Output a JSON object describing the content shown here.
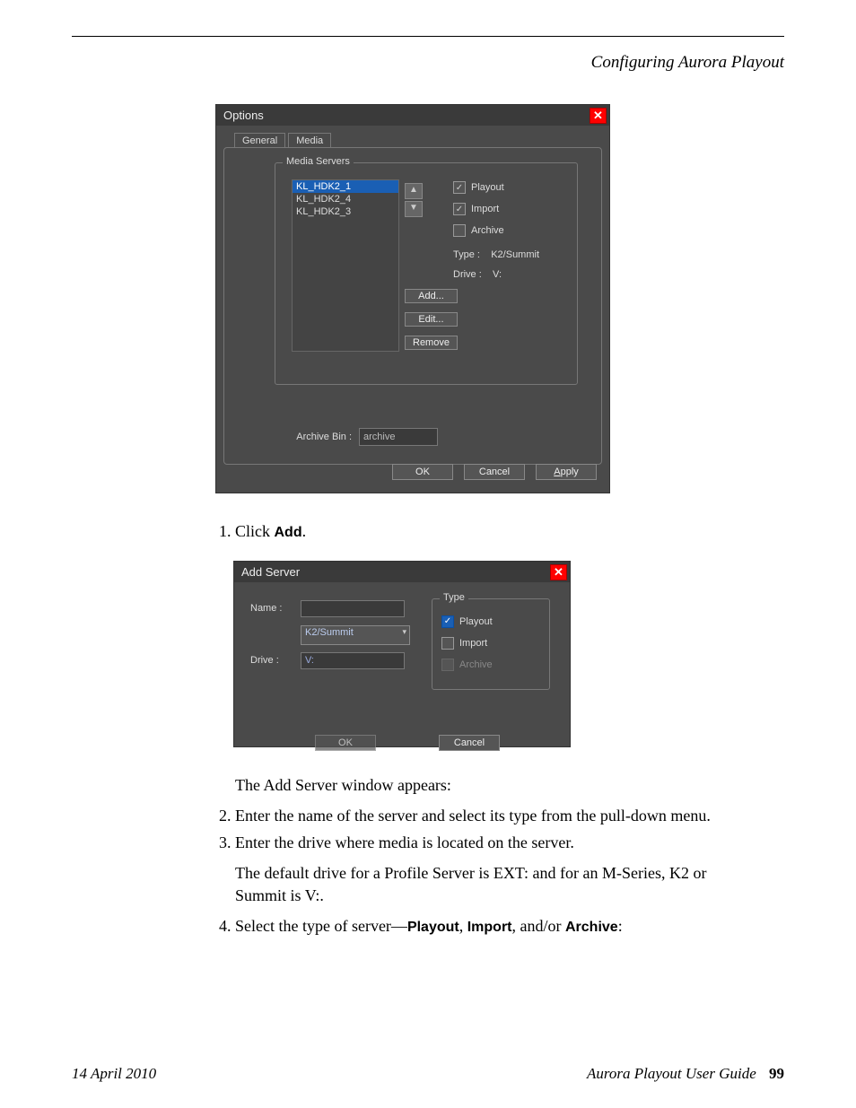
{
  "header": {
    "section_title": "Configuring Aurora Playout"
  },
  "options_dialog": {
    "title": "Options",
    "tabs": {
      "general": "General",
      "media": "Media"
    },
    "group_label": "Media Servers",
    "servers": [
      "KL_HDK2_1",
      "KL_HDK2_4",
      "KL_HDK2_3"
    ],
    "checks": {
      "playout": "Playout",
      "import": "Import",
      "archive": "Archive"
    },
    "type_label": "Type :",
    "type_value": "K2/Summit",
    "drive_label": "Drive :",
    "drive_value": "V:",
    "buttons": {
      "add": "Add...",
      "edit": "Edit...",
      "remove": "Remove"
    },
    "archive_bin_label": "Archive Bin :",
    "archive_bin_value": "archive",
    "footer_buttons": {
      "ok": "OK",
      "cancel": "Cancel",
      "apply": "Apply"
    }
  },
  "step1": {
    "prefix": "Click ",
    "bold": "Add",
    "suffix": "."
  },
  "addserver_dialog": {
    "title": "Add Server",
    "name_label": "Name :",
    "name_value": "",
    "type_select_value": "K2/Summit",
    "drive_label": "Drive :",
    "drive_value": "V:",
    "group_label": "Type",
    "checks": {
      "playout": "Playout",
      "import": "Import",
      "archive": "Archive"
    },
    "buttons": {
      "ok": "OK",
      "cancel": "Cancel"
    }
  },
  "paragraphs": {
    "p_after": "The Add Server window appears:",
    "step2": "Enter the name of the server and select its type from the pull-down menu.",
    "step3": "Enter the drive where media is located on the server.",
    "default_drive": "The default drive for a Profile Server is EXT: and for an M-Series, K2 or Summit is V:.",
    "step4_prefix": "Select the type of server—",
    "step4_b1": "Playout",
    "step4_m1": ", ",
    "step4_b2": "Import",
    "step4_m2": ", and/or ",
    "step4_b3": "Archive",
    "step4_suffix": ":"
  },
  "footer": {
    "date": "14  April  2010",
    "book": "Aurora Playout User Guide",
    "page": "99"
  }
}
